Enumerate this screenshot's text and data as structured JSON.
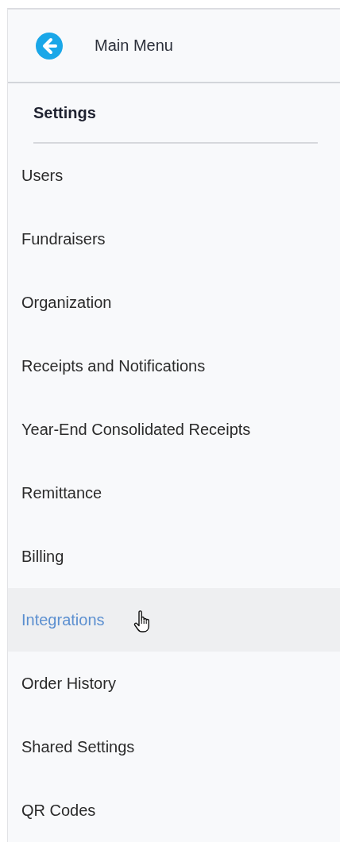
{
  "header": {
    "back_label": "Main Menu"
  },
  "section": {
    "title": "Settings"
  },
  "items": [
    {
      "label": "Users",
      "hovered": false
    },
    {
      "label": "Fundraisers",
      "hovered": false
    },
    {
      "label": "Organization",
      "hovered": false
    },
    {
      "label": "Receipts and Notifications",
      "hovered": false
    },
    {
      "label": "Year-End Consolidated Receipts",
      "hovered": false
    },
    {
      "label": "Remittance",
      "hovered": false
    },
    {
      "label": "Billing",
      "hovered": false
    },
    {
      "label": "Integrations",
      "hovered": true
    },
    {
      "label": "Order History",
      "hovered": false
    },
    {
      "label": "Shared Settings",
      "hovered": false
    },
    {
      "label": "QR Codes",
      "hovered": false
    }
  ]
}
